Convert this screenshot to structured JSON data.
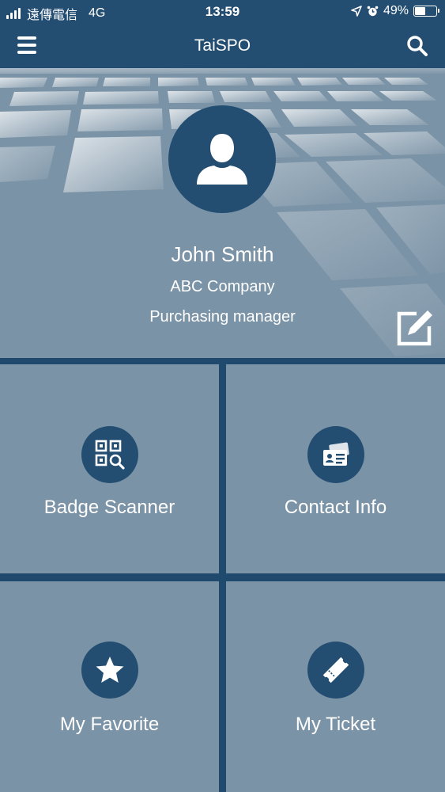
{
  "status_bar": {
    "carrier": "遠傳電信",
    "network": "4G",
    "time": "13:59",
    "battery": "49%",
    "battery_level": 0.49
  },
  "nav": {
    "title": "TaiSPO",
    "menu_icon": "hamburger-menu-icon",
    "search_icon": "search-icon"
  },
  "profile": {
    "name": "John Smith",
    "company": "ABC Company",
    "position": "Purchasing manager",
    "avatar_icon": "user-silhouette-icon",
    "edit_icon": "edit-icon"
  },
  "tiles": [
    {
      "label": "Badge Scanner",
      "icon": "qr-scan-icon"
    },
    {
      "label": "Contact Info",
      "icon": "contact-card-icon"
    },
    {
      "label": "My Favorite",
      "icon": "star-icon"
    },
    {
      "label": "My Ticket",
      "icon": "ticket-icon"
    }
  ],
  "colors": {
    "primary": "#234e72",
    "tile_background": "#7b93a6",
    "text": "#ffffff"
  }
}
